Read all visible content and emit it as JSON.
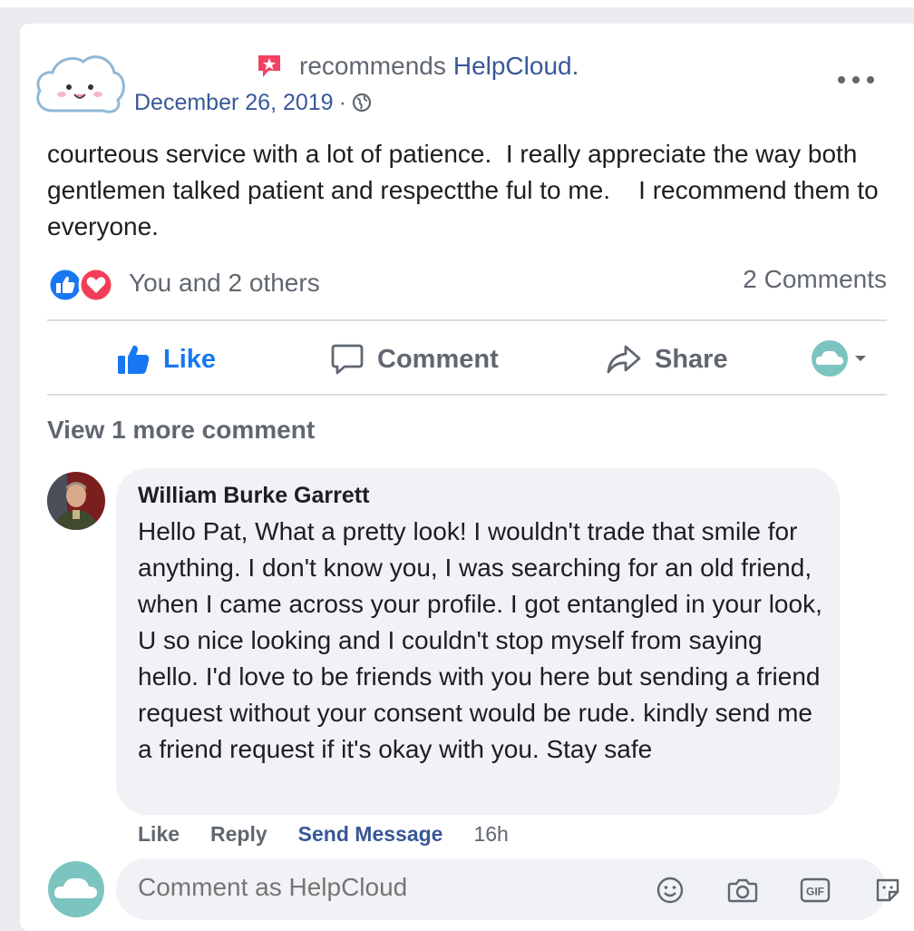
{
  "post": {
    "header": {
      "recommends_text": "recommends",
      "page_name": "HelpCloud",
      "page_name_suffix": ".",
      "date": "December 26, 2019",
      "date_separator": "·"
    },
    "body_text": "courteous service with a lot of patience.  I really appreciate the way both gentlemen talked patient and respectthe ful to me.    I recommend them to everyone.",
    "reactions": {
      "summary": "You and 2 others",
      "icons": [
        "like-icon",
        "love-icon"
      ]
    },
    "comment_count": "2 Comments",
    "actions": {
      "like": "Like",
      "comment": "Comment",
      "share": "Share"
    }
  },
  "comments": {
    "view_more": "View 1 more comment",
    "items": [
      {
        "author": "William Burke Garrett",
        "text": "Hello Pat, What a pretty look! I wouldn't trade that smile for anything. I don't know you, I was searching for an old friend, when I came across your profile. I got entangled in your look, U so nice looking and I couldn't stop myself from saying hello. I'd love to be friends with you here but sending a friend request without your consent would be rude. kindly send me a friend request if it's okay with you. Stay safe",
        "like": "Like",
        "reply": "Reply",
        "send_message": "Send Message",
        "time": "16h"
      }
    ]
  },
  "composer": {
    "placeholder": "Comment as HelpCloud",
    "icons": [
      "emoji-icon",
      "camera-icon",
      "gif-icon",
      "sticker-icon"
    ]
  },
  "colors": {
    "link": "#385898",
    "like_blue": "#1877f2",
    "muted": "#606770",
    "bubble": "#f0f2f5",
    "recommend_red": "#f3425f"
  }
}
